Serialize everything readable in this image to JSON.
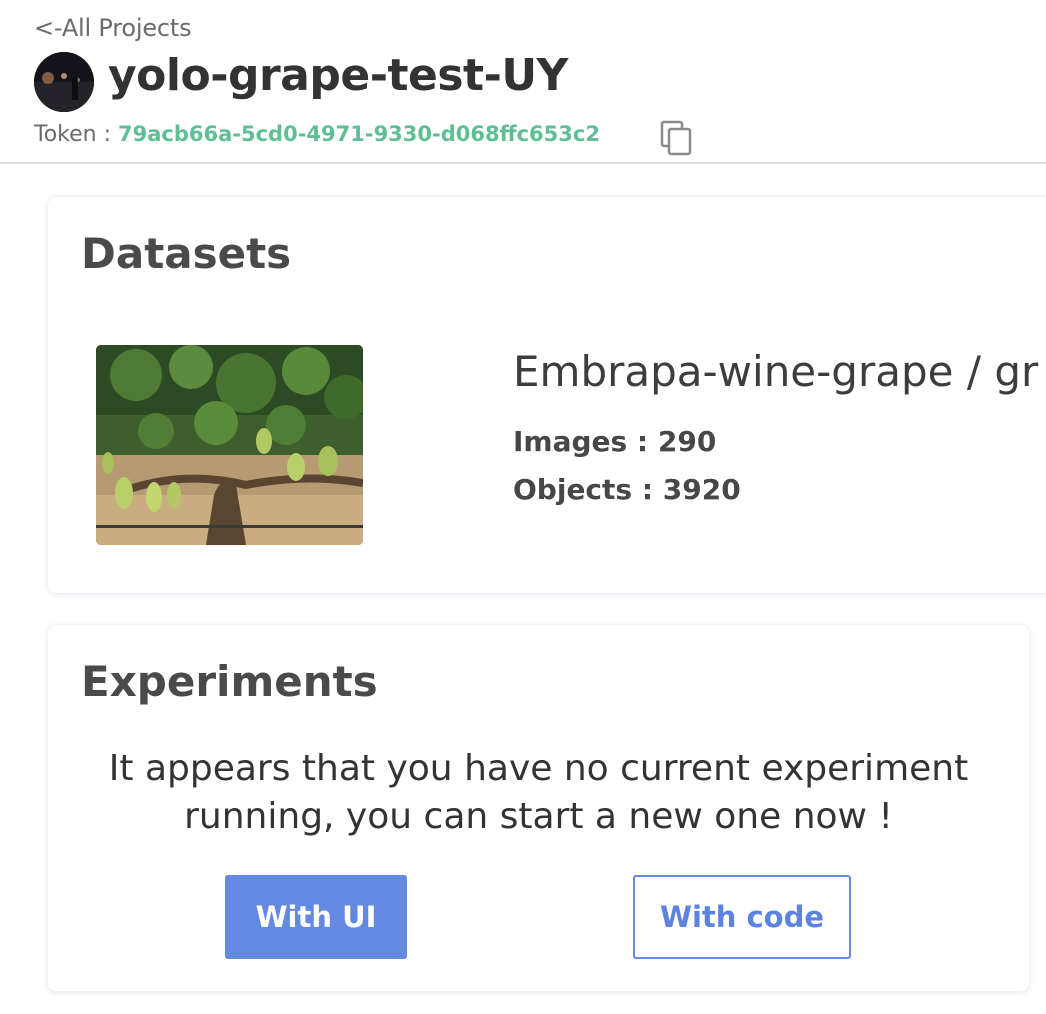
{
  "header": {
    "back_link": "<-All Projects",
    "project_title": "yolo-grape-test-UY",
    "token_label": "Token : ",
    "token_value": "79acb66a-5cd0-4971-9330-d068ffc653c2",
    "copy_icon": "copy-icon"
  },
  "datasets": {
    "title": "Datasets",
    "items": [
      {
        "name": "Embrapa-wine-grape / gr",
        "images": "Images : 290",
        "objects": "Objects : 3920",
        "thumbnail_icon": "grape-vineyard-image"
      }
    ]
  },
  "experiments": {
    "title": "Experiments",
    "empty_line_1": "It appears that you have no current experiment",
    "empty_line_2": "running, you can start a new one now !",
    "with_ui_label": "With UI",
    "with_code_label": "With code"
  },
  "colors": {
    "token": "#5fbf94",
    "primary_button": "#6389e0",
    "divider": "#dddddd"
  }
}
